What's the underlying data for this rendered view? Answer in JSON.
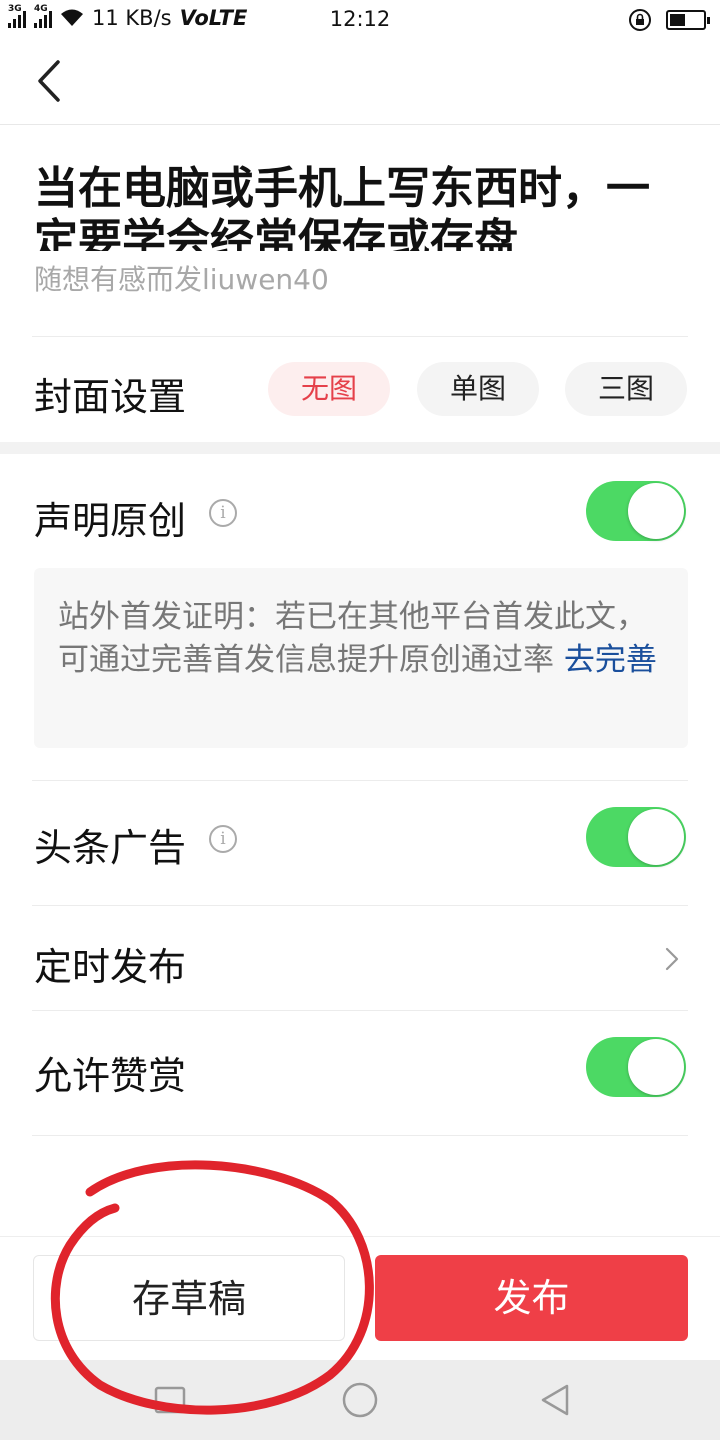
{
  "status_bar": {
    "net1": "3G",
    "net2": "4G",
    "speed": "11 KB/s",
    "volte": "VoLTE",
    "time": "12:12",
    "battery_level_percent": 45
  },
  "header": {
    "back_icon": "chevron-left-icon"
  },
  "article": {
    "title": "当在电脑或手机上写东西时，一定要学会经常保存或存盘",
    "author": "随想有感而发liuwen40"
  },
  "cover": {
    "label": "封面设置",
    "options": [
      "无图",
      "单图",
      "三图"
    ],
    "selected": "无图",
    "accent_color": "#e5404a"
  },
  "original": {
    "label": "声明原创",
    "info_icon": "info-icon",
    "enabled": true,
    "notice_text": "站外首发证明：若已在其他平台首发此文，可通过完善首发信息提升原创通过率",
    "notice_link": "去完善"
  },
  "ads": {
    "label": "头条广告",
    "info_icon": "info-icon",
    "enabled": true
  },
  "schedule": {
    "label": "定时发布",
    "icon": "chevron-right-icon"
  },
  "reward": {
    "label": "允许赞赏",
    "enabled": true
  },
  "actions": {
    "draft_label": "存草稿",
    "publish_label": "发布",
    "publish_color": "#ef3f47"
  },
  "toggle_color": "#4cd964",
  "nav": {
    "icons": [
      "recent-apps-icon",
      "home-icon",
      "back-triangle-icon"
    ]
  }
}
